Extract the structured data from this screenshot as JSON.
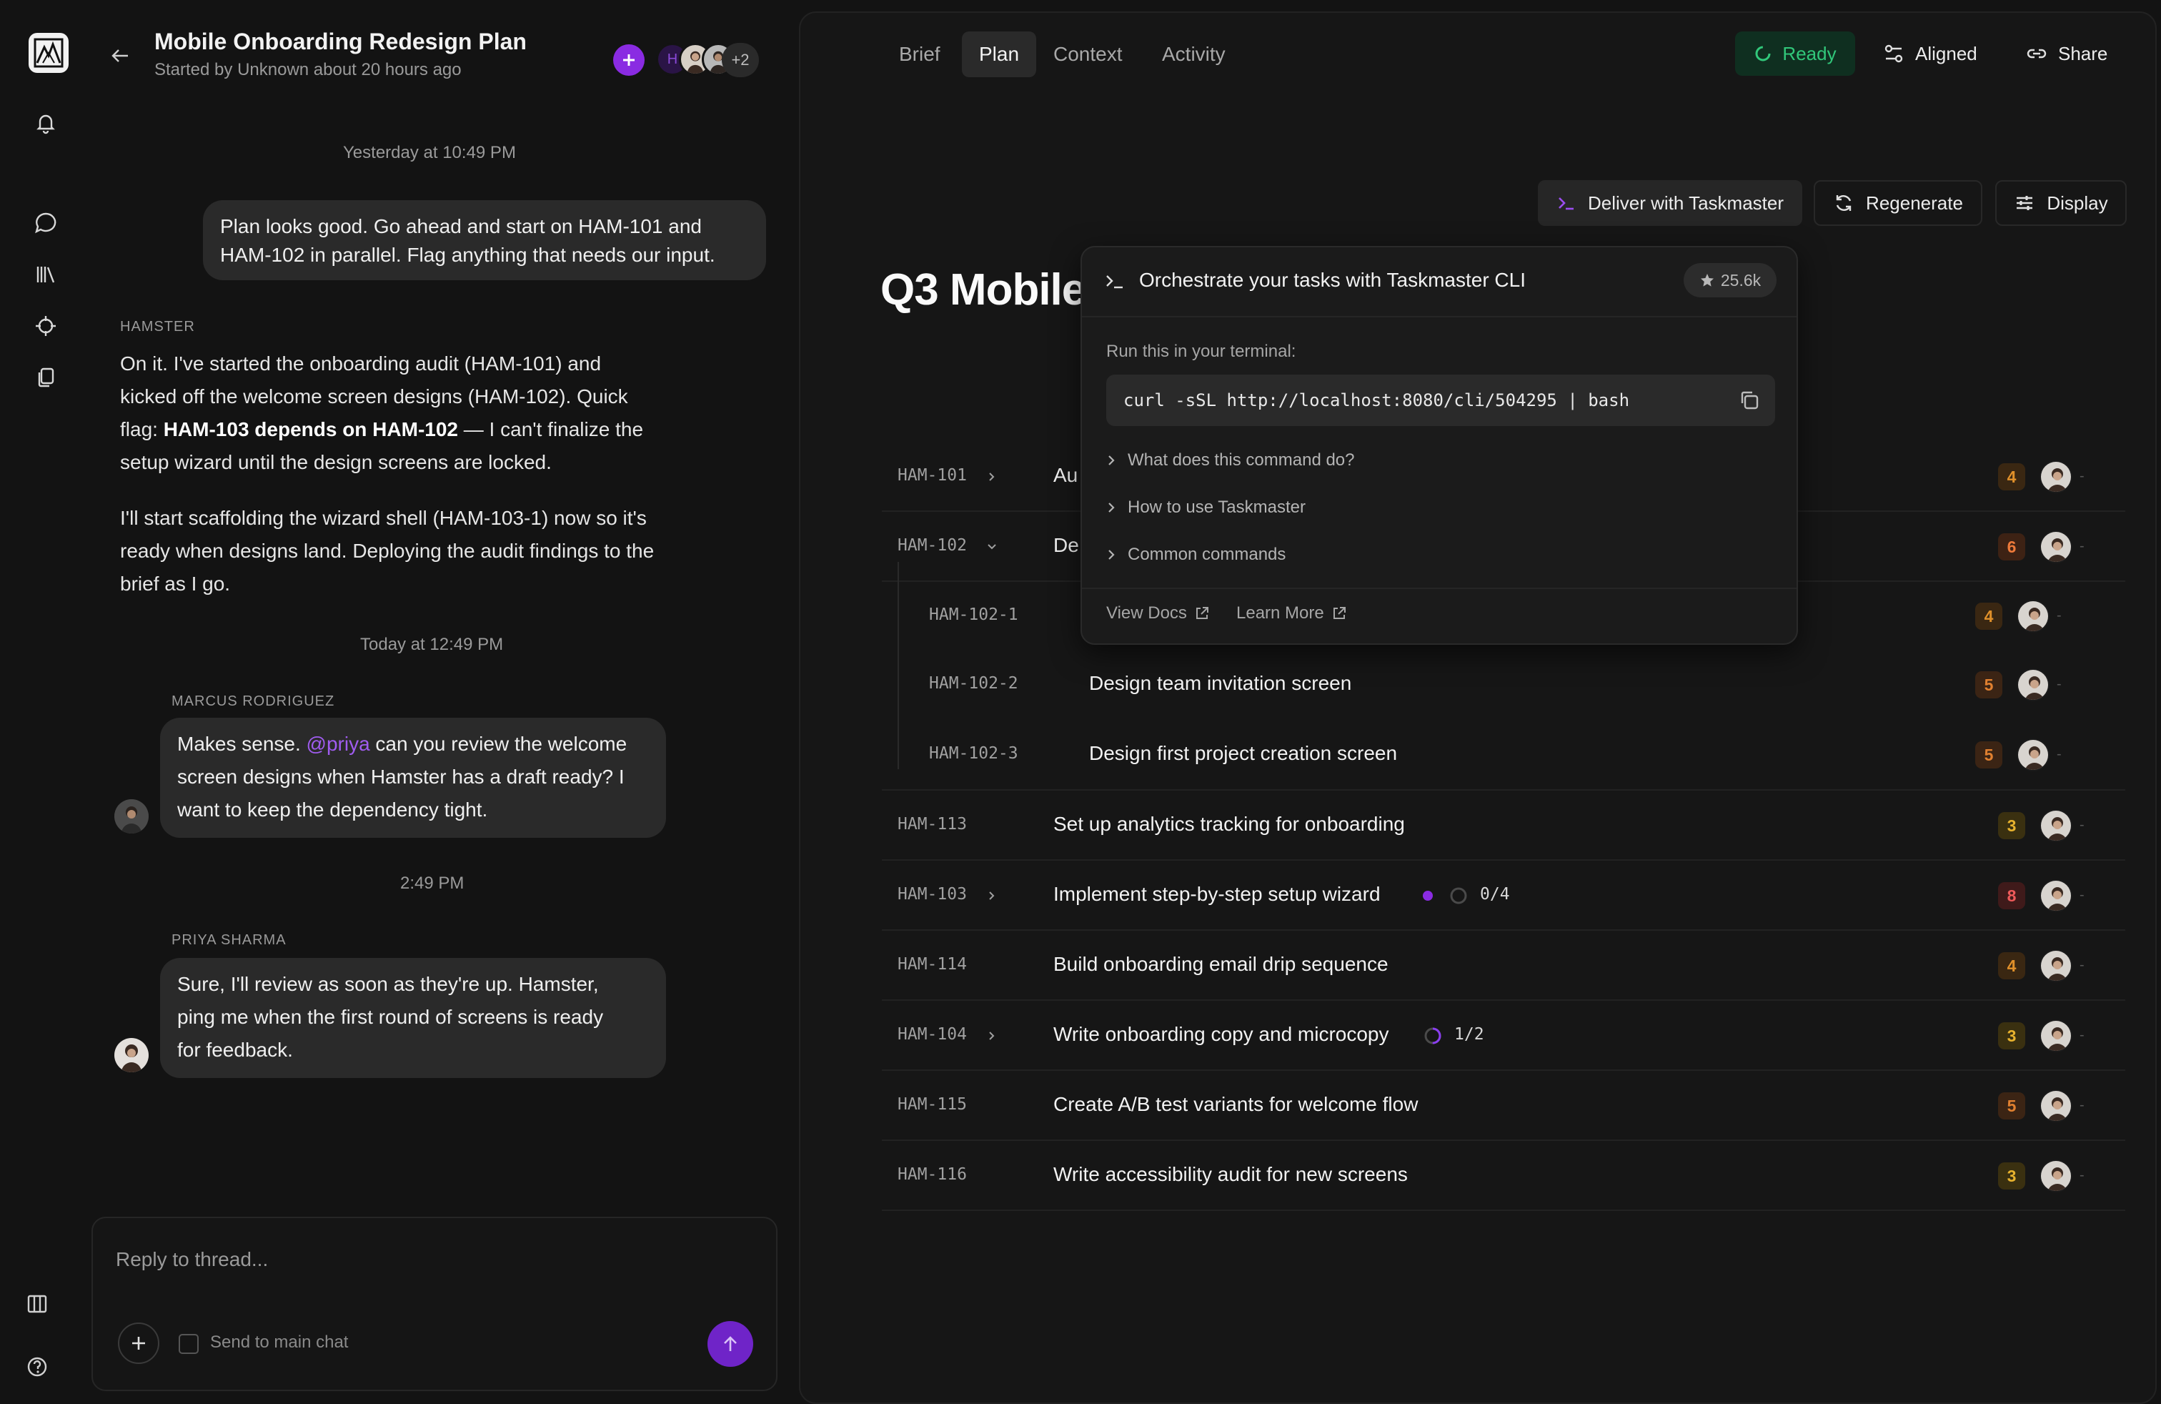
{
  "thread": {
    "title": "Mobile Onboarding Redesign Plan",
    "subtitle": "Started by Unknown about 20 hours ago",
    "participant_initial": "H",
    "participants_more": "+2"
  },
  "messages": {
    "ts1": "Yesterday at 10:49 PM",
    "user1_line1": "Plan looks good. Go ahead and start on HAM-101 and",
    "user1_line2": "HAM-102 in parallel. Flag anything that needs our input.",
    "hamster_label": "HAMSTER",
    "hamster_p1_l1": "On it. I've started the onboarding audit (HAM-101) and",
    "hamster_p1_l2": "kicked off the welcome screen designs (HAM-102). Quick",
    "hamster_p1_l3a": "flag: ",
    "hamster_p1_l3b": "HAM-103 depends on HAM-102",
    "hamster_p1_l3c": " — I can't finalize the",
    "hamster_p1_l4": "setup wizard until the design screens are locked.",
    "hamster_p2_l1": "I'll start scaffolding the wizard shell (HAM-103-1) now so it's",
    "hamster_p2_l2": "ready when designs land. Deploying the audit findings to the",
    "hamster_p2_l3": "brief as I go.",
    "ts2": "Today at 12:49 PM",
    "marcus_label": "MARCUS RODRIGUEZ",
    "marcus_l1a": "Makes sense. ",
    "marcus_mention": "@priya",
    "marcus_l1b": " can you review the welcome",
    "marcus_l2": "screen designs when Hamster has a draft ready? I",
    "marcus_l3": "want to keep the dependency tight.",
    "ts3": "2:49 PM",
    "priya_label": "PRIYA SHARMA",
    "priya_l1": "Sure, I'll review as soon as they're up. Hamster,",
    "priya_l2": "ping me when the first round of screens is ready",
    "priya_l3": "for feedback."
  },
  "reply": {
    "placeholder": "Reply to thread...",
    "send_to_main": "Send to main chat"
  },
  "tabs": [
    "Brief",
    "Plan",
    "Context",
    "Activity"
  ],
  "header_actions": {
    "ready": "Ready",
    "aligned": "Aligned",
    "share": "Share"
  },
  "toolbar": {
    "deliver": "Deliver with Taskmaster",
    "regenerate": "Regenerate",
    "display": "Display"
  },
  "plan": {
    "heading": "Q3 Mobile"
  },
  "tasks": [
    {
      "id": "HAM-101",
      "title": "Au",
      "score": "4",
      "score_color": "#e0902a",
      "score_bg": "#3a2712"
    },
    {
      "id": "HAM-102",
      "title": "De",
      "score": "6",
      "score_color": "#ee7a3a",
      "score_bg": "#3d2214"
    },
    {
      "id": "HAM-102-1",
      "title": "",
      "score": "4",
      "score_color": "#e0902a",
      "score_bg": "#3a2712"
    },
    {
      "id": "HAM-102-2",
      "title": "Design team invitation screen",
      "score": "5",
      "score_color": "#e08030",
      "score_bg": "#3b2414"
    },
    {
      "id": "HAM-102-3",
      "title": "Design first project creation screen",
      "score": "5",
      "score_color": "#e08030",
      "score_bg": "#3b2414"
    },
    {
      "id": "HAM-113",
      "title": "Set up analytics tracking for onboarding",
      "score": "3",
      "score_color": "#e7b22e",
      "score_bg": "#3a3010"
    },
    {
      "id": "HAM-103",
      "title": "Implement step-by-step setup wizard",
      "score": "8",
      "score_color": "#ee5a5a",
      "score_bg": "#3f1a1a",
      "progress": "0/4",
      "progress_fraction": 0
    },
    {
      "id": "HAM-114",
      "title": "Build onboarding email drip sequence",
      "score": "4",
      "score_color": "#e0902a",
      "score_bg": "#3a2712"
    },
    {
      "id": "HAM-104",
      "title": "Write onboarding copy and microcopy",
      "score": "3",
      "score_color": "#e7b22e",
      "score_bg": "#3a3010",
      "progress": "1/2",
      "progress_fraction": 0.5
    },
    {
      "id": "HAM-115",
      "title": "Create A/B test variants for welcome flow",
      "score": "5",
      "score_color": "#e08030",
      "score_bg": "#3b2414"
    },
    {
      "id": "HAM-116",
      "title": "Write accessibility audit for new screens",
      "score": "3",
      "score_color": "#e7b22e",
      "score_bg": "#3a3010"
    }
  ],
  "popover": {
    "title": "Orchestrate your tasks with Taskmaster CLI",
    "stars": "25.6k",
    "run_label": "Run this in your terminal:",
    "command": "curl -sSL http://localhost:8080/cli/504295 | bash",
    "faq": [
      "What does this command do?",
      "How to use Taskmaster",
      "Common commands"
    ],
    "view_docs": "View Docs",
    "learn_more": "Learn More"
  },
  "colors": {
    "accent": "#8a2be2",
    "ready_green": "#31c77a"
  }
}
